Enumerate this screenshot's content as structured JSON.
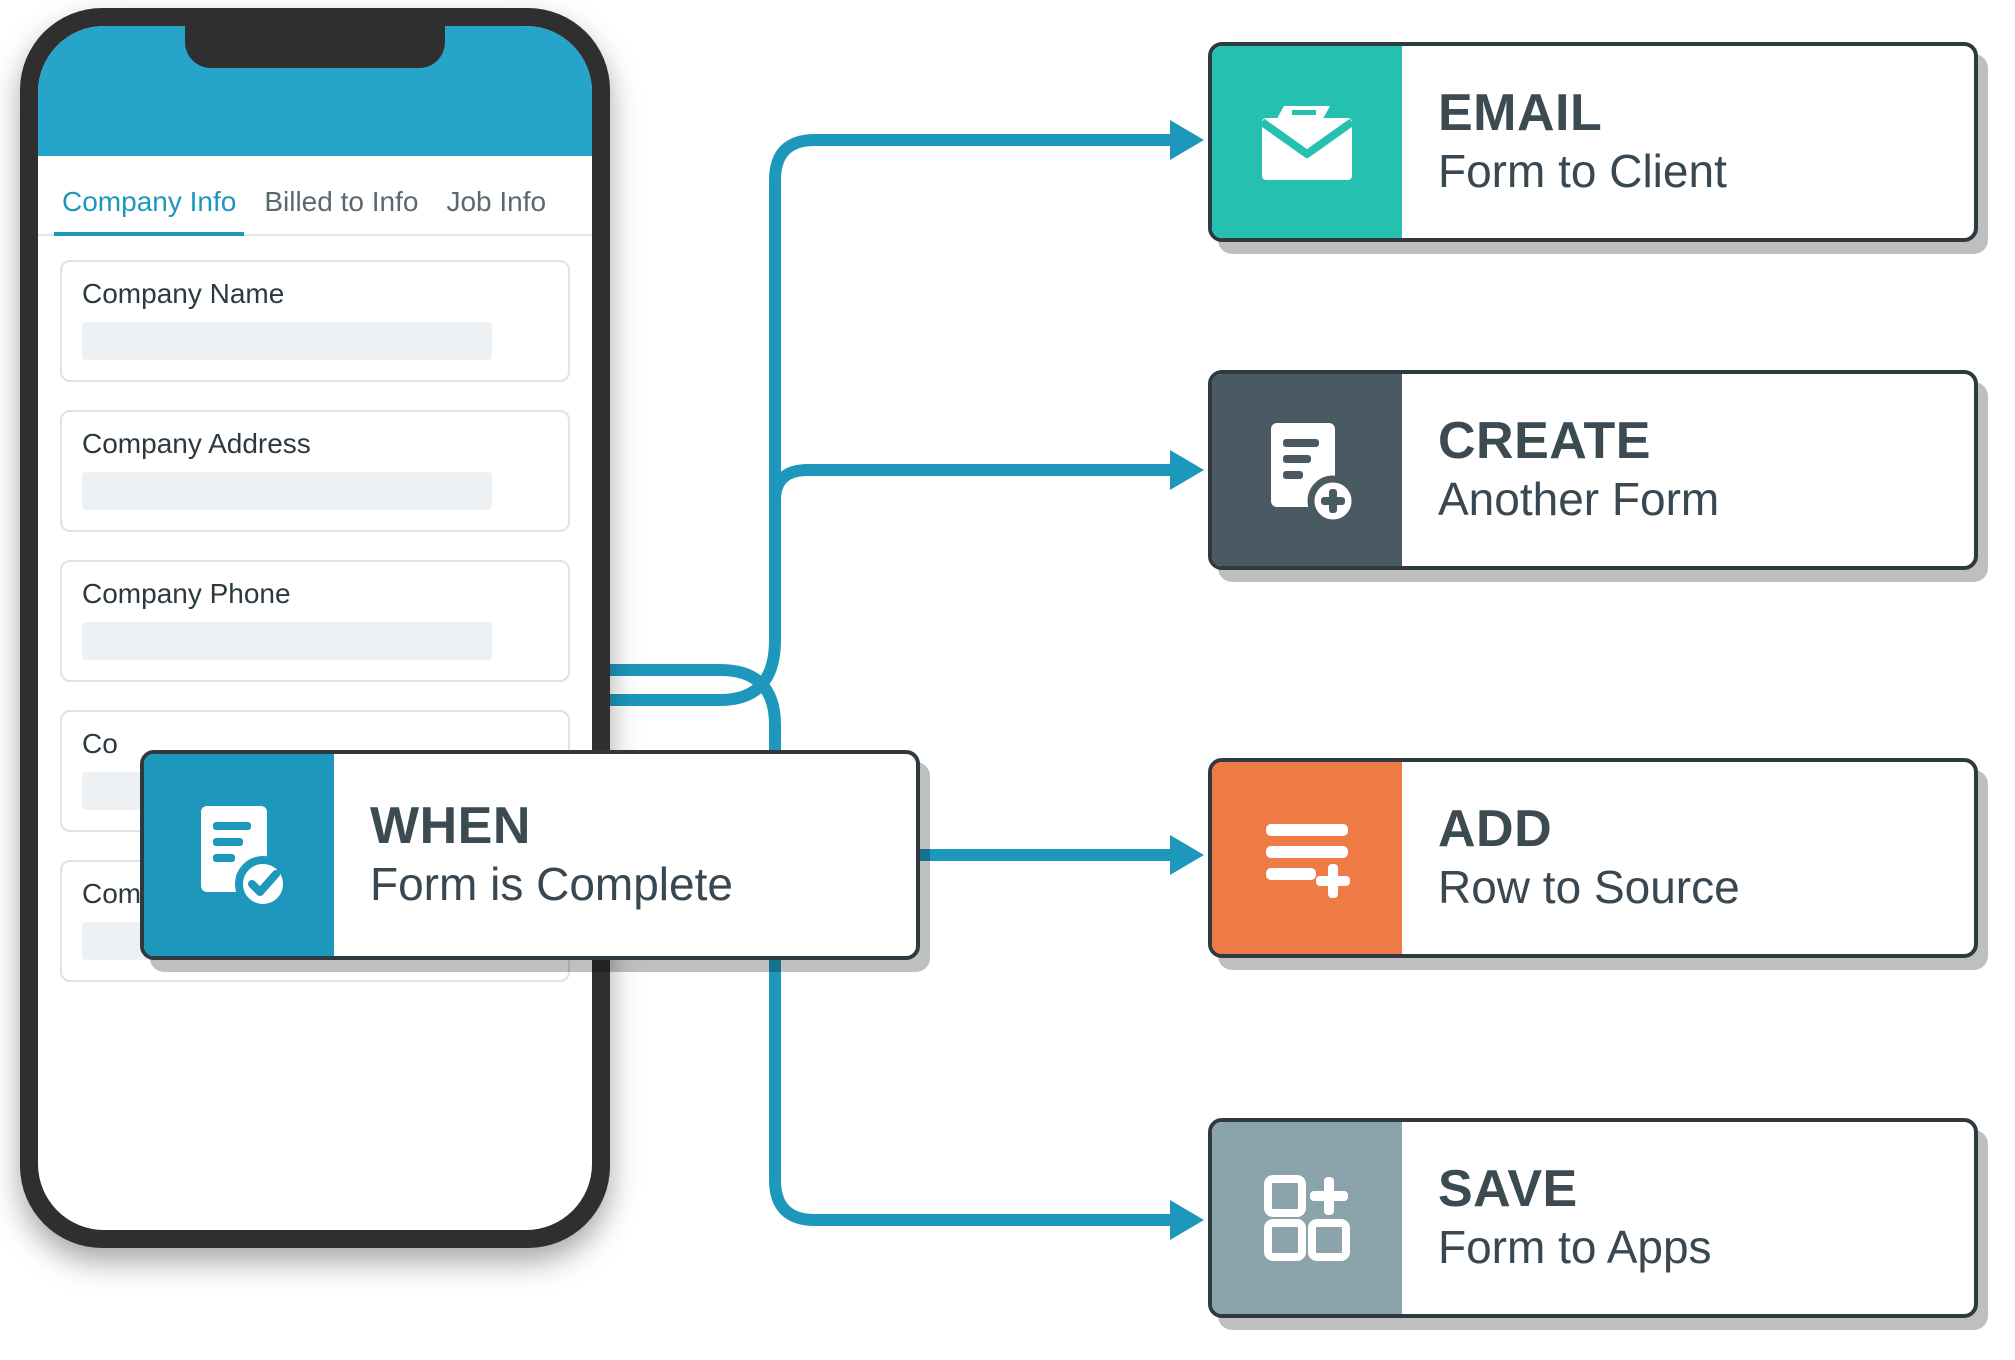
{
  "phone": {
    "tabs": [
      {
        "label": "Company Info",
        "active": true
      },
      {
        "label": "Billed to Info",
        "active": false
      },
      {
        "label": "Job Info",
        "active": false
      }
    ],
    "fields": [
      {
        "label": "Company Name"
      },
      {
        "label": "Company Address"
      },
      {
        "label": "Company Phone"
      },
      {
        "label": "Company Email",
        "partial_behind": "Co"
      },
      {
        "label": "Company Email"
      }
    ]
  },
  "trigger": {
    "title": "WHEN",
    "subtitle": "Form is Complete",
    "icon": "document-check-icon",
    "color": "#1e97bd"
  },
  "actions": [
    {
      "id": "email",
      "title": "EMAIL",
      "subtitle": "Form to Client",
      "icon": "envelope-icon",
      "color": "#26c0b0"
    },
    {
      "id": "create",
      "title": "CREATE",
      "subtitle": "Another Form",
      "icon": "document-add-icon",
      "color": "#4a5a63"
    },
    {
      "id": "add",
      "title": "ADD",
      "subtitle": "Row to Source",
      "icon": "rows-add-icon",
      "color": "#ee7a46"
    },
    {
      "id": "save",
      "title": "SAVE",
      "subtitle": "Form to Apps",
      "icon": "app-grid-add-icon",
      "color": "#8ba3aa"
    }
  ]
}
